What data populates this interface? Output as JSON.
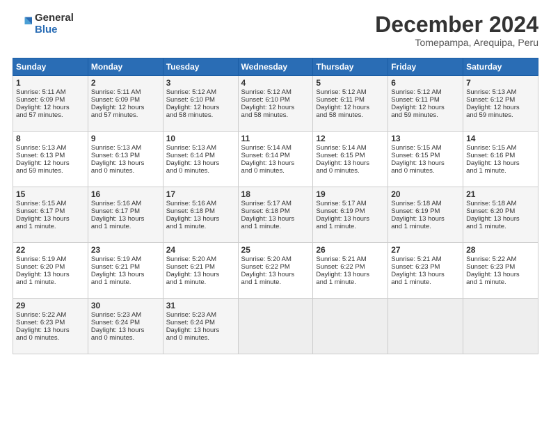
{
  "header": {
    "logo_general": "General",
    "logo_blue": "Blue",
    "month_title": "December 2024",
    "subtitle": "Tomepampa, Arequipa, Peru"
  },
  "weekdays": [
    "Sunday",
    "Monday",
    "Tuesday",
    "Wednesday",
    "Thursday",
    "Friday",
    "Saturday"
  ],
  "rows": [
    [
      {
        "day": "1",
        "line1": "Sunrise: 5:11 AM",
        "line2": "Sunset: 6:09 PM",
        "line3": "Daylight: 12 hours",
        "line4": "and 57 minutes."
      },
      {
        "day": "2",
        "line1": "Sunrise: 5:11 AM",
        "line2": "Sunset: 6:09 PM",
        "line3": "Daylight: 12 hours",
        "line4": "and 57 minutes."
      },
      {
        "day": "3",
        "line1": "Sunrise: 5:12 AM",
        "line2": "Sunset: 6:10 PM",
        "line3": "Daylight: 12 hours",
        "line4": "and 58 minutes."
      },
      {
        "day": "4",
        "line1": "Sunrise: 5:12 AM",
        "line2": "Sunset: 6:10 PM",
        "line3": "Daylight: 12 hours",
        "line4": "and 58 minutes."
      },
      {
        "day": "5",
        "line1": "Sunrise: 5:12 AM",
        "line2": "Sunset: 6:11 PM",
        "line3": "Daylight: 12 hours",
        "line4": "and 58 minutes."
      },
      {
        "day": "6",
        "line1": "Sunrise: 5:12 AM",
        "line2": "Sunset: 6:11 PM",
        "line3": "Daylight: 12 hours",
        "line4": "and 59 minutes."
      },
      {
        "day": "7",
        "line1": "Sunrise: 5:13 AM",
        "line2": "Sunset: 6:12 PM",
        "line3": "Daylight: 12 hours",
        "line4": "and 59 minutes."
      }
    ],
    [
      {
        "day": "8",
        "line1": "Sunrise: 5:13 AM",
        "line2": "Sunset: 6:13 PM",
        "line3": "Daylight: 12 hours",
        "line4": "and 59 minutes."
      },
      {
        "day": "9",
        "line1": "Sunrise: 5:13 AM",
        "line2": "Sunset: 6:13 PM",
        "line3": "Daylight: 13 hours",
        "line4": "and 0 minutes."
      },
      {
        "day": "10",
        "line1": "Sunrise: 5:13 AM",
        "line2": "Sunset: 6:14 PM",
        "line3": "Daylight: 13 hours",
        "line4": "and 0 minutes."
      },
      {
        "day": "11",
        "line1": "Sunrise: 5:14 AM",
        "line2": "Sunset: 6:14 PM",
        "line3": "Daylight: 13 hours",
        "line4": "and 0 minutes."
      },
      {
        "day": "12",
        "line1": "Sunrise: 5:14 AM",
        "line2": "Sunset: 6:15 PM",
        "line3": "Daylight: 13 hours",
        "line4": "and 0 minutes."
      },
      {
        "day": "13",
        "line1": "Sunrise: 5:15 AM",
        "line2": "Sunset: 6:15 PM",
        "line3": "Daylight: 13 hours",
        "line4": "and 0 minutes."
      },
      {
        "day": "14",
        "line1": "Sunrise: 5:15 AM",
        "line2": "Sunset: 6:16 PM",
        "line3": "Daylight: 13 hours",
        "line4": "and 1 minute."
      }
    ],
    [
      {
        "day": "15",
        "line1": "Sunrise: 5:15 AM",
        "line2": "Sunset: 6:17 PM",
        "line3": "Daylight: 13 hours",
        "line4": "and 1 minute."
      },
      {
        "day": "16",
        "line1": "Sunrise: 5:16 AM",
        "line2": "Sunset: 6:17 PM",
        "line3": "Daylight: 13 hours",
        "line4": "and 1 minute."
      },
      {
        "day": "17",
        "line1": "Sunrise: 5:16 AM",
        "line2": "Sunset: 6:18 PM",
        "line3": "Daylight: 13 hours",
        "line4": "and 1 minute."
      },
      {
        "day": "18",
        "line1": "Sunrise: 5:17 AM",
        "line2": "Sunset: 6:18 PM",
        "line3": "Daylight: 13 hours",
        "line4": "and 1 minute."
      },
      {
        "day": "19",
        "line1": "Sunrise: 5:17 AM",
        "line2": "Sunset: 6:19 PM",
        "line3": "Daylight: 13 hours",
        "line4": "and 1 minute."
      },
      {
        "day": "20",
        "line1": "Sunrise: 5:18 AM",
        "line2": "Sunset: 6:19 PM",
        "line3": "Daylight: 13 hours",
        "line4": "and 1 minute."
      },
      {
        "day": "21",
        "line1": "Sunrise: 5:18 AM",
        "line2": "Sunset: 6:20 PM",
        "line3": "Daylight: 13 hours",
        "line4": "and 1 minute."
      }
    ],
    [
      {
        "day": "22",
        "line1": "Sunrise: 5:19 AM",
        "line2": "Sunset: 6:20 PM",
        "line3": "Daylight: 13 hours",
        "line4": "and 1 minute."
      },
      {
        "day": "23",
        "line1": "Sunrise: 5:19 AM",
        "line2": "Sunset: 6:21 PM",
        "line3": "Daylight: 13 hours",
        "line4": "and 1 minute."
      },
      {
        "day": "24",
        "line1": "Sunrise: 5:20 AM",
        "line2": "Sunset: 6:21 PM",
        "line3": "Daylight: 13 hours",
        "line4": "and 1 minute."
      },
      {
        "day": "25",
        "line1": "Sunrise: 5:20 AM",
        "line2": "Sunset: 6:22 PM",
        "line3": "Daylight: 13 hours",
        "line4": "and 1 minute."
      },
      {
        "day": "26",
        "line1": "Sunrise: 5:21 AM",
        "line2": "Sunset: 6:22 PM",
        "line3": "Daylight: 13 hours",
        "line4": "and 1 minute."
      },
      {
        "day": "27",
        "line1": "Sunrise: 5:21 AM",
        "line2": "Sunset: 6:23 PM",
        "line3": "Daylight: 13 hours",
        "line4": "and 1 minute."
      },
      {
        "day": "28",
        "line1": "Sunrise: 5:22 AM",
        "line2": "Sunset: 6:23 PM",
        "line3": "Daylight: 13 hours",
        "line4": "and 1 minute."
      }
    ],
    [
      {
        "day": "29",
        "line1": "Sunrise: 5:22 AM",
        "line2": "Sunset: 6:23 PM",
        "line3": "Daylight: 13 hours",
        "line4": "and 0 minutes."
      },
      {
        "day": "30",
        "line1": "Sunrise: 5:23 AM",
        "line2": "Sunset: 6:24 PM",
        "line3": "Daylight: 13 hours",
        "line4": "and 0 minutes."
      },
      {
        "day": "31",
        "line1": "Sunrise: 5:23 AM",
        "line2": "Sunset: 6:24 PM",
        "line3": "Daylight: 13 hours",
        "line4": "and 0 minutes."
      },
      null,
      null,
      null,
      null
    ]
  ]
}
